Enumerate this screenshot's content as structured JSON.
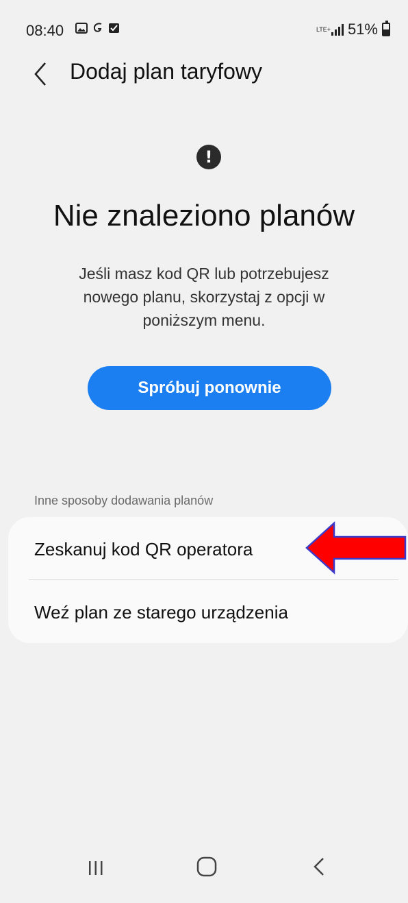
{
  "status_bar": {
    "time": "08:40",
    "left_icons": [
      "gallery-icon",
      "script-g-icon",
      "checkbox-icon"
    ],
    "network": "LTE+",
    "battery": "51%"
  },
  "header": {
    "title": "Dodaj plan taryfowy",
    "back_icon": "chevron-left-icon"
  },
  "empty_state": {
    "icon": "exclamation-icon",
    "title": "Nie znaleziono planów",
    "description": "Jeśli masz kod QR lub potrzebujesz nowego planu, skorzystaj z opcji w poniższym menu."
  },
  "retry_button": {
    "label": "Spróbuj ponownie",
    "color": "#1b7ff2"
  },
  "other_methods": {
    "label": "Inne sposoby dodawania planów",
    "items": [
      {
        "label": "Zeskanuj kod QR operatora"
      },
      {
        "label": "Weź plan ze starego urządzenia"
      }
    ]
  },
  "annotation": {
    "arrow_color": "#ff0000",
    "arrow_outline": "#3a3acb"
  },
  "nav_bar": {
    "recents_icon": "recents-icon",
    "home_icon": "home-icon",
    "back_icon": "back-icon"
  }
}
